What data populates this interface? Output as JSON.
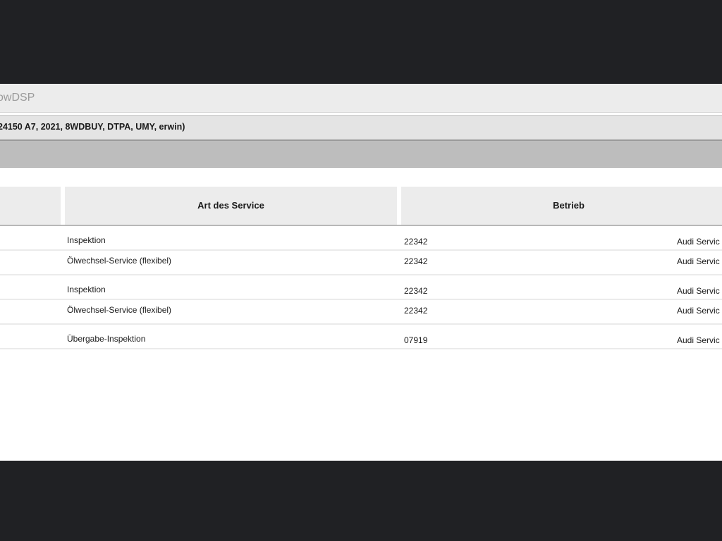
{
  "window": {
    "title": "owDSP"
  },
  "vehicle_info": "24150 A7, 2021, 8WDBUY, DTPA, UMY, erwin)",
  "table": {
    "columns": [
      "",
      "Art des Service",
      "Betrieb"
    ],
    "rows": [
      {
        "service": "Inspektion",
        "code": "22342",
        "betrieb": "Audi Servic"
      },
      {
        "service": "Ölwechsel-Service (flexibel)",
        "code": "22342",
        "betrieb": "Audi Servic"
      },
      {
        "service": "Inspektion",
        "code": "22342",
        "betrieb": "Audi Servic"
      },
      {
        "service": "Ölwechsel-Service (flexibel)",
        "code": "22342",
        "betrieb": "Audi Servic"
      },
      {
        "service": "Übergabe-Inspektion",
        "code": "07919",
        "betrieb": "Audi Servic"
      }
    ]
  }
}
